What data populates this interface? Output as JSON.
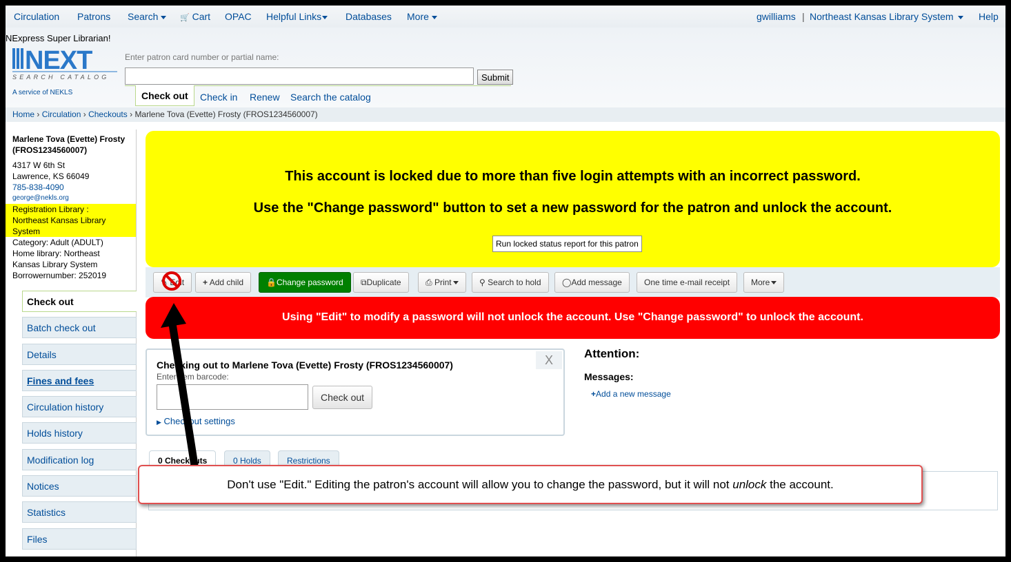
{
  "topnav": {
    "circulation": "Circulation",
    "patrons": "Patrons",
    "search": "Search",
    "cart": "Cart",
    "opac": "OPAC",
    "helpful_links": "Helpful Links",
    "databases": "Databases",
    "more": "More",
    "user": "gwilliams",
    "library": "Northeast Kansas Library System",
    "help": "Help"
  },
  "header": {
    "tagline": "NExpress Super Librarian!",
    "logo_text": "NEXT",
    "logo_subtext": "SEARCH CATALOG",
    "service_text": "A service of NEKLS",
    "search_label": "Enter patron card number or partial name:",
    "submit": "Submit",
    "tabs": [
      "Check out",
      "Check in",
      "Renew",
      "Search the catalog"
    ]
  },
  "breadcrumb": {
    "home": "Home",
    "circulation": "Circulation",
    "checkouts": "Checkouts",
    "current": "Marlene Tova (Evette) Frosty (FROS1234560007)"
  },
  "patron": {
    "name": "Marlene Tova (Evette) Frosty",
    "card": "(FROS1234560007)",
    "address1": "4317 W 6th St",
    "address2": "Lawrence, KS 66049",
    "phone": "785-838-4090",
    "email": "george@nekls.org",
    "reg_library_label": "Registration Library :",
    "reg_library_1": "Northeast Kansas Library",
    "reg_library_2": "System",
    "category": "Category: Adult (ADULT)",
    "home_library_1": "Home library: Northeast",
    "home_library_2": "Kansas Library System",
    "borrowernumber": "Borrowernumber: 252019"
  },
  "menu": [
    "Check out",
    "Batch check out",
    "Details",
    "Fines and fees",
    "Circulation history",
    "Holds history",
    "Modification log",
    "Notices",
    "Statistics",
    "Files"
  ],
  "alert": {
    "line1": "This account is locked due to more than five login attempts with an incorrect password.",
    "line2": "Use the \"Change password\" button to set a new password for the patron and unlock the account.",
    "report_button": "Run locked status report for this patron"
  },
  "toolbar": {
    "edit": "Edit",
    "add_child": "Add child",
    "change_password": "Change password",
    "duplicate": "Duplicate",
    "print": "Print",
    "search_hold": "Search to hold",
    "add_message": "Add message",
    "email_receipt": "One time e-mail receipt",
    "more": "More"
  },
  "warning": "Using \"Edit\" to modify a password will not unlock the account. Use \"Change password\" to unlock the account.",
  "checkout": {
    "title": "Checking out to Marlene Tova (Evette) Frosty (FROS1234560007)",
    "label": "Enter item barcode:",
    "button": "Check out",
    "settings": "Checkout settings",
    "close": "X"
  },
  "attention": {
    "title": "Attention:",
    "messages": "Messages:",
    "add_message": "Add a new message"
  },
  "bottom_tabs": [
    "0 Checkouts",
    "0 Holds",
    "Restrictions"
  ],
  "callout": {
    "before": "Don't use \"Edit.\"  Editing the patron's account will allow you to change the password, but it will not ",
    "emph": "unlock",
    "after": " the account."
  },
  "colors": {
    "link": "#004d99",
    "alert_yellow": "#ffff00",
    "warning_red": "#ff0000",
    "change_password_green": "#008000"
  }
}
